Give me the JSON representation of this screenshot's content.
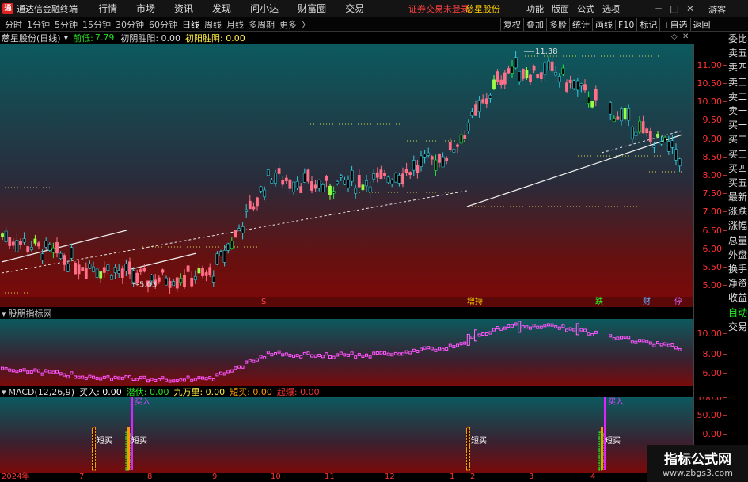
{
  "app": {
    "title": "通达信金融终端",
    "logo": "通"
  },
  "menu": [
    "行情",
    "市场",
    "资讯",
    "发现",
    "问小达",
    "财富圈",
    "交易"
  ],
  "login_status": "证券交易未登录",
  "stock_title": "慈星股份",
  "right_menu": [
    "功能",
    "版面",
    "公式",
    "选项"
  ],
  "guest_label": "游客",
  "periods": [
    "分时",
    "1分钟",
    "5分钟",
    "15分钟",
    "30分钟",
    "60分钟",
    "日线",
    "周线",
    "月线",
    "多周期",
    "更多"
  ],
  "active_period": "日线",
  "tools": [
    "复权",
    "叠加",
    "多股",
    "统计",
    "画线",
    "F10",
    "标记",
    "+自选",
    "返回"
  ],
  "main_header": {
    "name": "慈星股份(日线)",
    "pre_low_label": "前低:",
    "pre_low_value": "7.79",
    "item1": "初阴胜阳: 0.00",
    "item2": "初阳胜阴: 0.00"
  },
  "ind1_header": "股朋指标网",
  "ind2_header": {
    "name": "MACD(12,26,9)",
    "buy": "买入: 0.00",
    "lurk": "潜伏: 0.00",
    "nine": "九万里: 0.00",
    "short_buy": "短买: 0.00",
    "rise": "起爆: 0.00"
  },
  "sidebar_items": [
    "委比",
    "卖五",
    "卖四",
    "卖三",
    "卖二",
    "卖一",
    "买一",
    "买二",
    "买三",
    "买四",
    "买五",
    "最新",
    "涨跌",
    "涨幅",
    "总量",
    "外盘",
    "换手",
    "净资",
    "收益"
  ],
  "sidebar_auto": "自动",
  "sidebar_trade": "交易",
  "main_y": [
    "11.00",
    "10.50",
    "10.00",
    "9.50",
    "9.00",
    "8.50",
    "8.00",
    "7.50",
    "7.00",
    "6.50",
    "6.00",
    "5.50",
    "5.00"
  ],
  "ind1_y": [
    "10.00",
    "8.00",
    "6.00"
  ],
  "ind2_y": [
    "100.0",
    "50.00",
    "0.00"
  ],
  "dates": [
    "2024年",
    "7",
    "8",
    "9",
    "10",
    "11",
    "12",
    "1",
    "2",
    "3",
    "4"
  ],
  "markers": [
    {
      "label": "S",
      "color": "#ff4444"
    },
    {
      "label": "增持",
      "color": "#ffcc00"
    },
    {
      "label": "跌",
      "color": "#22ff22"
    },
    {
      "label": "财",
      "color": "#66aaff"
    },
    {
      "label": "停",
      "color": "#dd66ff"
    }
  ],
  "annotations": {
    "high": "11.38",
    "low": "5.03"
  },
  "signals": {
    "short_buy": "短买",
    "buy": "买入"
  },
  "watermark": {
    "title": "指标公式网",
    "url": "www.zbgs3.com"
  },
  "chart_data": {
    "type": "candlestick",
    "y_range": [
      4.7,
      11.6
    ],
    "series": [
      {
        "date": "2024-06",
        "close": 6.4
      },
      {
        "date": "2024-07",
        "close": 5.6
      },
      {
        "date": "2024-08",
        "close": 5.2
      },
      {
        "date": "2024-09",
        "close": 5.3
      },
      {
        "date": "2024-10",
        "close": 8.0
      },
      {
        "date": "2024-11",
        "close": 7.7
      },
      {
        "date": "2024-12",
        "close": 7.9
      },
      {
        "date": "2025-01",
        "close": 8.6
      },
      {
        "date": "2025-02",
        "close": 10.9
      },
      {
        "date": "2025-03",
        "close": 10.8
      },
      {
        "date": "2025-04",
        "close": 8.5
      }
    ],
    "period_high": 11.38,
    "period_low": 5.03
  }
}
